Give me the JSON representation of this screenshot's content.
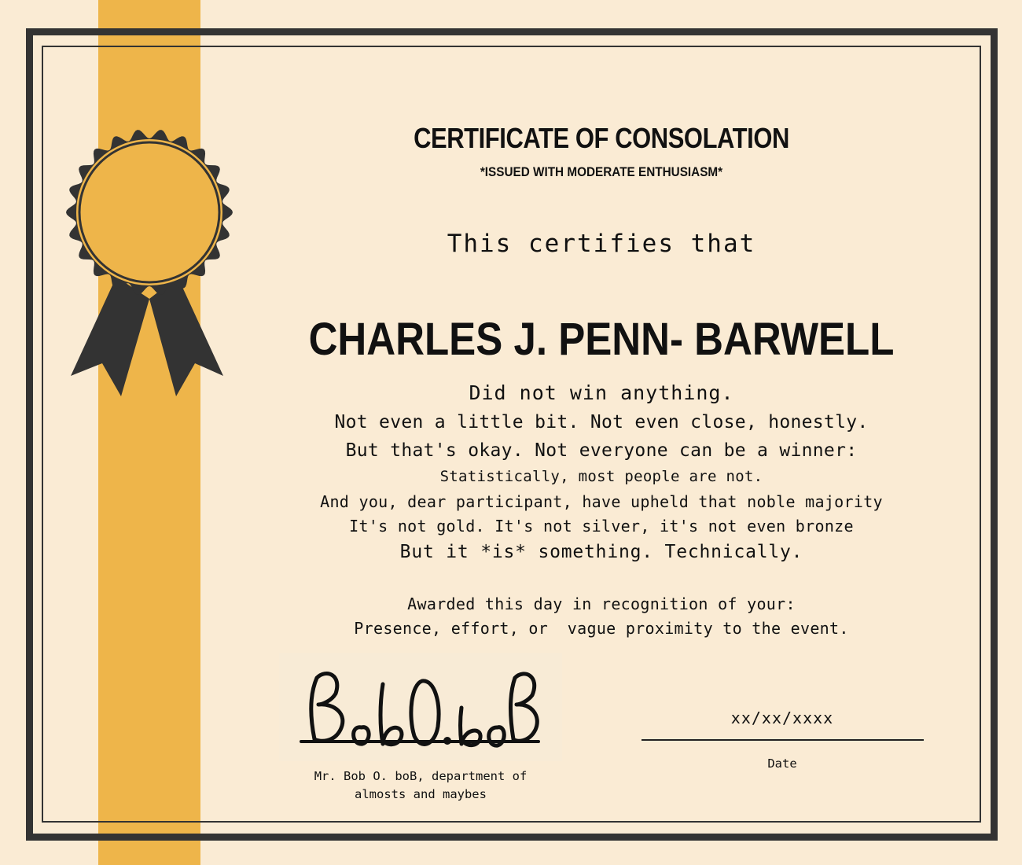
{
  "colors": {
    "background": "#faebd4",
    "accent_gold": "#eeb54a",
    "border_dark": "#333333",
    "text": "#111111"
  },
  "certificate": {
    "title": "CERTIFICATE OF CONSOLATION",
    "subtitle": "*ISSUED WITH MODERATE ENTHUSIASM*",
    "certifies_text": "This certifies that",
    "recipient_name": "CHARLES J. PENN- BARWELL",
    "body_lines": [
      "Did not win anything.",
      "Not even a little bit. Not even close, honestly.",
      "But that's okay. Not everyone can be a winner:",
      "Statistically, most people are not.",
      "And you, dear participant, have upheld that noble majority",
      "It's not gold. It's not silver, it's not even bronze",
      "But it *is* something. Technically."
    ],
    "awarded_lines": [
      "Awarded this day in recognition of your:",
      "Presence, effort, or  vague proximity to the event."
    ]
  },
  "signature": {
    "handwriting": "BobO.boB",
    "caption_lines": [
      "Mr. Bob O. boB, department of",
      "almosts and maybes"
    ]
  },
  "date": {
    "value": "xx/xx/xxxx",
    "label": "Date"
  },
  "seal": {
    "icon": "award-ribbon-seal-icon"
  }
}
